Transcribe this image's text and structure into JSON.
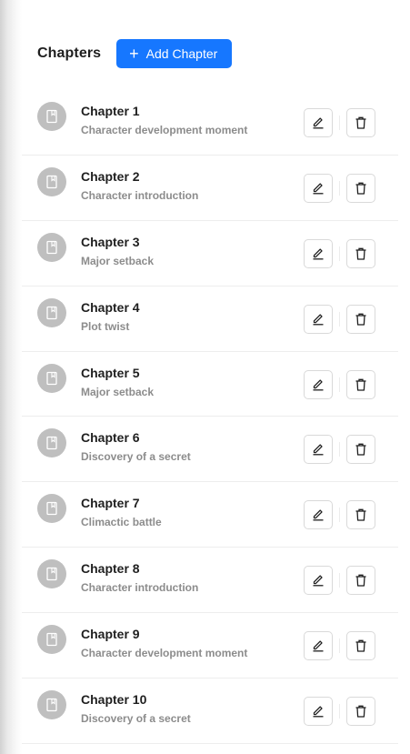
{
  "header": {
    "title": "Chapters",
    "add_button_label": "Add Chapter"
  },
  "chapters": [
    {
      "title": "Chapter 1",
      "description": "Character development moment"
    },
    {
      "title": "Chapter 2",
      "description": "Character introduction"
    },
    {
      "title": "Chapter 3",
      "description": "Major setback"
    },
    {
      "title": "Chapter 4",
      "description": "Plot twist"
    },
    {
      "title": "Chapter 5",
      "description": "Major setback"
    },
    {
      "title": "Chapter 6",
      "description": "Discovery of a secret"
    },
    {
      "title": "Chapter 7",
      "description": "Climactic battle"
    },
    {
      "title": "Chapter 8",
      "description": "Character introduction"
    },
    {
      "title": "Chapter 9",
      "description": "Character development moment"
    },
    {
      "title": "Chapter 10",
      "description": "Discovery of a secret"
    }
  ],
  "icons": {
    "avatar": "book-icon",
    "edit": "edit-icon",
    "delete": "delete-icon",
    "add": "plus-icon"
  },
  "colors": {
    "accent": "#1677ff",
    "avatar_bg": "#bfbfbf",
    "description": "#8c8c8c"
  }
}
